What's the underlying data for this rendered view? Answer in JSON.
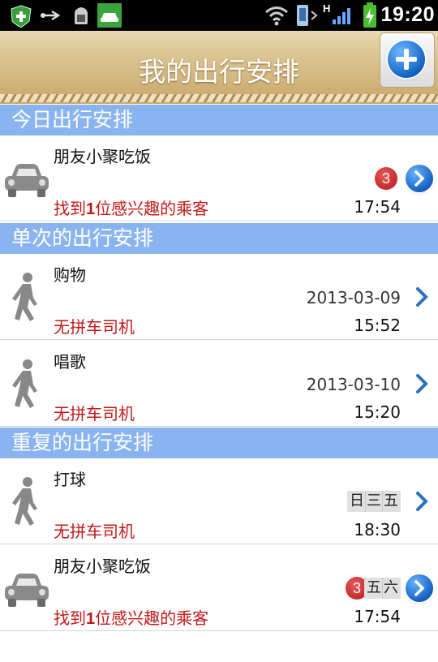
{
  "status_bar": {
    "time": "19:20"
  },
  "header": {
    "title": "我的出行安排"
  },
  "sections": {
    "today": {
      "label": "今日出行安排"
    },
    "single": {
      "label": "单次的出行安排"
    },
    "repeat": {
      "label": "重复的出行安排"
    }
  },
  "today_items": [
    {
      "title": "朋友小聚吃饭",
      "status_prefix": "找到",
      "status_num": "1",
      "status_suffix": "位感兴趣的乘客",
      "badge": "3",
      "time": "17:54",
      "icon": "car-icon"
    }
  ],
  "single_items": [
    {
      "title": "购物",
      "status": "无拼车司机",
      "date": "2013-03-09",
      "time": "15:52",
      "icon": "walking-person-icon"
    },
    {
      "title": "唱歌",
      "status": "无拼车司机",
      "date": "2013-03-10",
      "time": "15:20",
      "icon": "walking-person-icon"
    }
  ],
  "repeat_items": [
    {
      "title": "打球",
      "status": "无拼车司机",
      "days": [
        "日",
        "三",
        "五"
      ],
      "time": "18:30",
      "icon": "walking-person-icon"
    },
    {
      "title": "朋友小聚吃饭",
      "status_prefix": "找到",
      "status_num": "1",
      "status_suffix": "位感兴趣的乘客",
      "badge": "3",
      "days": [
        "五",
        "六"
      ],
      "time": "17:54",
      "icon": "car-icon"
    }
  ],
  "colors": {
    "section_bg": "#8ab4f0",
    "status_red": "#c01818",
    "accent_blue": "#1462c0"
  }
}
